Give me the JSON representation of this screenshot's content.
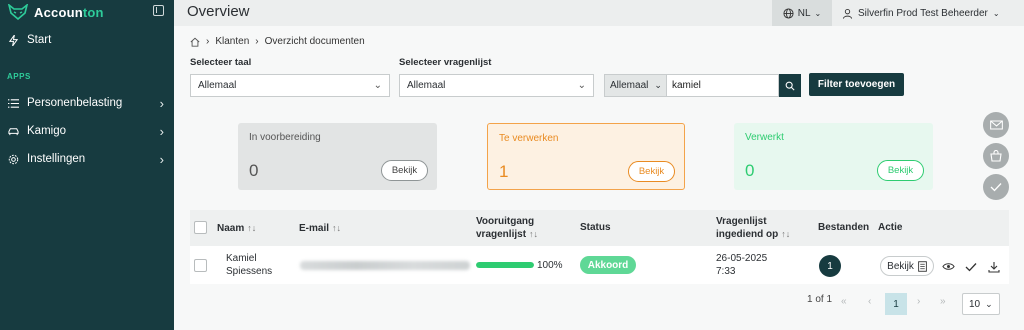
{
  "app": {
    "logo_prefix": "Accoun",
    "logo_suffix": "ton"
  },
  "sidebar": {
    "start": "Start",
    "apps_label": "APPS",
    "items": [
      {
        "label": "Personenbelasting",
        "icon": "list-icon"
      },
      {
        "label": "Kamigo",
        "icon": "car-icon"
      },
      {
        "label": "Instellingen",
        "icon": "gear-icon"
      }
    ]
  },
  "header": {
    "title": "Overview",
    "language": "NL",
    "user": "Silverfin Prod Test Beheerder"
  },
  "breadcrumb": {
    "items": [
      "Klanten",
      "Overzicht documenten"
    ]
  },
  "filters": {
    "taal_label": "Selecteer taal",
    "taal_value": "Allemaal",
    "vragenlijst_label": "Selecteer vragenlijst",
    "vragenlijst_value": "Allemaal",
    "search_scope": "Allemaal",
    "search_value": "kamiel",
    "filter_button": "Filter toevoegen"
  },
  "cards": [
    {
      "title": "In voorbereiding",
      "count": "0",
      "button": "Bekijk"
    },
    {
      "title": "Te verwerken",
      "count": "1",
      "button": "Bekijk"
    },
    {
      "title": "Verwerkt",
      "count": "0",
      "button": "Bekijk"
    }
  ],
  "table": {
    "headers": {
      "naam": "Naam",
      "email": "E-mail",
      "voortgang_1": "Vooruitgang",
      "voortgang_2": "vragenlijst",
      "status": "Status",
      "ingediend_1": "Vragenlijst",
      "ingediend_2": "ingediend op",
      "bestanden": "Bestanden",
      "actie": "Actie"
    },
    "rows": [
      {
        "name_1": "Kamiel",
        "name_2": "Spiessens",
        "progress_percent": 100,
        "progress_label": "100%",
        "status": "Akkoord",
        "date": "26-05-2025",
        "time": "7:33",
        "files": "1",
        "action": "Bekijk"
      }
    ]
  },
  "pagination": {
    "summary": "1 of 1",
    "current": "1",
    "page_size": "10"
  },
  "colors": {
    "sidebar": "#173b40",
    "accent_green": "#2ecc71",
    "accent_orange": "#e98b22"
  }
}
